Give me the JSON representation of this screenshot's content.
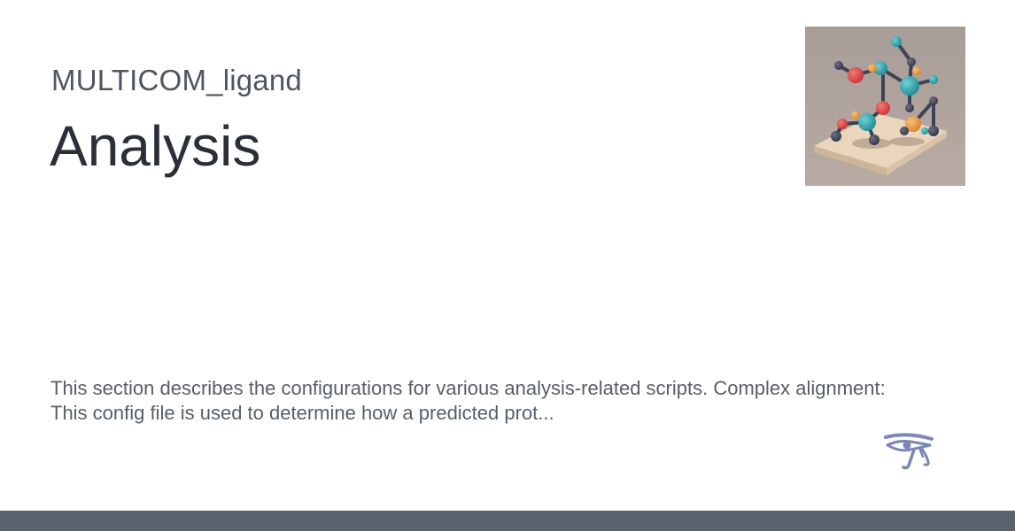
{
  "header": {
    "project_name": "MULTICOM_ligand",
    "title": "Analysis"
  },
  "main": {
    "description": "This section describes the configurations for various analysis-related scripts. Complex alignment: This config file is used to determine how a predicted prot..."
  },
  "images": {
    "hero_icon": "molecule-illustration-icon",
    "logo_icon": "eye-of-horus-icon"
  },
  "colors": {
    "footer_bar": "#5b616d",
    "title_text": "#2b2f37",
    "body_text": "#585e69",
    "logo": "#7b87b4"
  }
}
